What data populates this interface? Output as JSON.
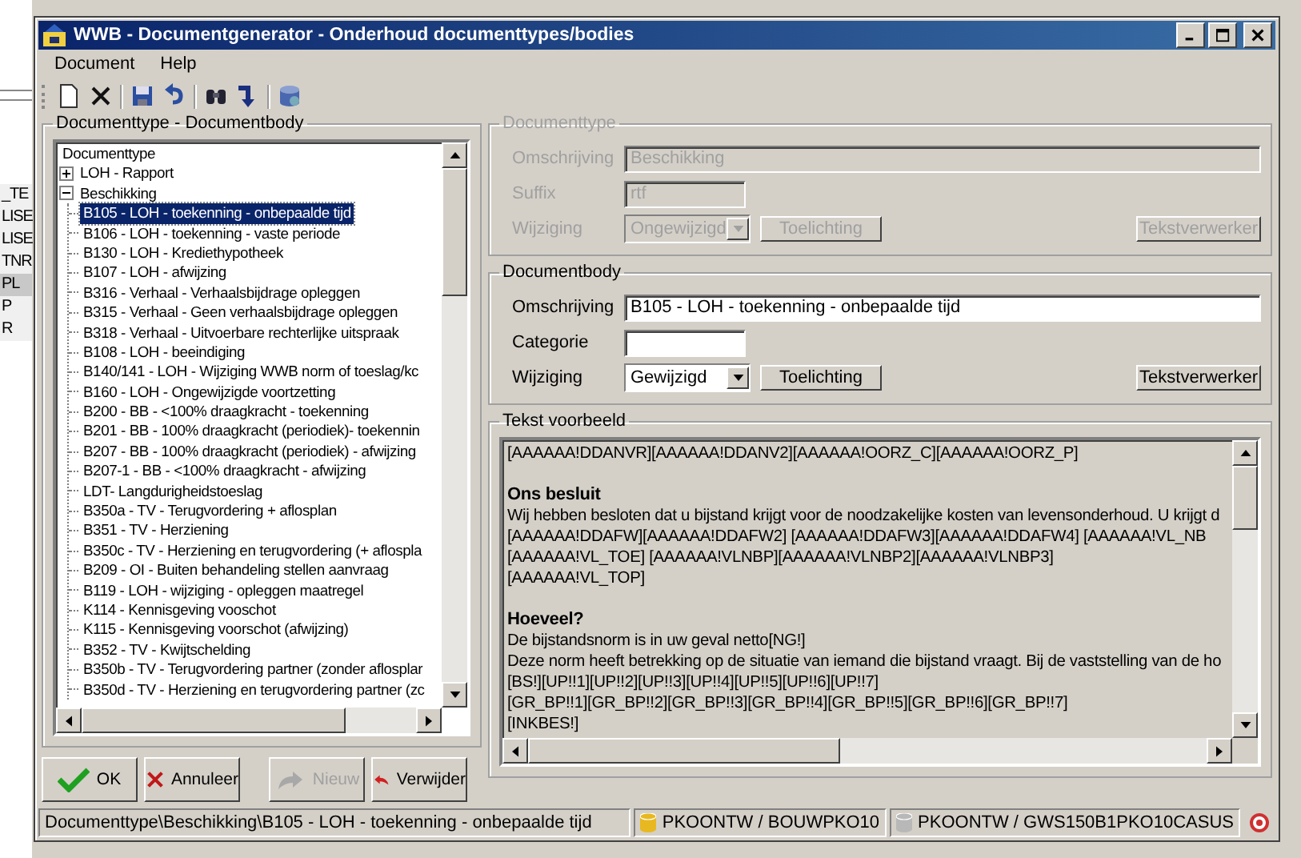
{
  "background_list": [
    {
      "label": "_TE",
      "selected": false
    },
    {
      "label": "LISE",
      "selected": false
    },
    {
      "label": "LISE",
      "selected": false
    },
    {
      "label": "TNR",
      "selected": false
    },
    {
      "label": "PL",
      "selected": true
    },
    {
      "label": "P",
      "selected": false
    },
    {
      "label": "R",
      "selected": false
    }
  ],
  "window": {
    "title": "WWB - Documentgenerator - Onderhoud documenttypes/bodies"
  },
  "menu": [
    "Document",
    "Help"
  ],
  "tree_panel": {
    "title": "Documenttype - Documentbody",
    "tree": {
      "label": "Documenttype",
      "selected": false,
      "children": [
        {
          "label": "LOH - Rapport",
          "expanded": false,
          "selected": false
        },
        {
          "label": "Beschikking",
          "expanded": true,
          "selected": false,
          "children": [
            {
              "label": "B105 - LOH - toekenning - onbepaalde tijd",
              "selected": true
            },
            {
              "label": "B106 - LOH - toekenning - vaste periode",
              "selected": false
            },
            {
              "label": "B130 - LOH - Krediethypotheek",
              "selected": false
            },
            {
              "label": "B107 - LOH - afwijzing",
              "selected": false
            },
            {
              "label": "B316 - Verhaal - Verhaalsbijdrage opleggen",
              "selected": false
            },
            {
              "label": "B315 - Verhaal - Geen verhaalsbijdrage opleggen",
              "selected": false
            },
            {
              "label": "B318 - Verhaal - Uitvoerbare rechterlijke uitspraak",
              "selected": false
            },
            {
              "label": "B108 - LOH - beeindiging",
              "selected": false
            },
            {
              "label": "B140/141 - LOH - Wijziging WWB norm of toeslag/kc",
              "selected": false
            },
            {
              "label": "B160 - LOH - Ongewijzigde voortzetting",
              "selected": false
            },
            {
              "label": "B200 - BB - <100% draagkracht - toekenning",
              "selected": false
            },
            {
              "label": "B201 - BB - 100% draagkracht  (periodiek)- toekennin",
              "selected": false
            },
            {
              "label": "B207 - BB - 100% draagkracht (periodiek) - afwijzing",
              "selected": false
            },
            {
              "label": "B207-1 - BB - <100% draagkracht - afwijzing",
              "selected": false
            },
            {
              "label": "LDT- Langdurigheidstoeslag",
              "selected": false
            },
            {
              "label": "B350a - TV - Terugvordering + aflosplan",
              "selected": false
            },
            {
              "label": "B351   - TV - Herziening",
              "selected": false
            },
            {
              "label": "B350c - TV - Herziening en terugvordering (+ aflospla",
              "selected": false
            },
            {
              "label": "B209 - OI - Buiten behandeling stellen aanvraag",
              "selected": false
            },
            {
              "label": "B119 - LOH - wijziging - opleggen maatregel",
              "selected": false
            },
            {
              "label": "K114 - Kennisgeving vooschot",
              "selected": false
            },
            {
              "label": "K115 - Kennisgeving voorschot (afwijzing)",
              "selected": false
            },
            {
              "label": "B352 - TV - Kwijtschelding",
              "selected": false
            },
            {
              "label": "B350b - TV - Terugvordering partner (zonder aflosplar",
              "selected": false
            },
            {
              "label": "B350d - TV - Herziening en terugvordering partner (zc",
              "selected": false
            }
          ]
        }
      ]
    }
  },
  "documenttype": {
    "title": "Documenttype",
    "disabled": true,
    "fields": [
      {
        "kind": "text",
        "label": "Omschrijving",
        "value": "Beschikking",
        "wide": true
      },
      {
        "kind": "text",
        "label": "Suffix",
        "value": "rtf",
        "wide": false
      },
      {
        "kind": "combo",
        "label": "Wijziging",
        "value": "Ongewijzigd",
        "buttons": [
          "Toelichting",
          "Tekstverwerker"
        ]
      }
    ]
  },
  "documentbody": {
    "title": "Documentbody",
    "disabled": false,
    "fields": [
      {
        "kind": "text",
        "label": "Omschrijving",
        "value": "B105 - LOH - toekenning - onbepaalde tijd",
        "wide": true
      },
      {
        "kind": "text",
        "label": "Categorie",
        "wide": false
      },
      {
        "kind": "combo",
        "label": "Wijziging",
        "value": "Gewijzigd",
        "buttons": [
          "Toelichting",
          "Tekstverwerker"
        ]
      }
    ]
  },
  "preview": {
    "title": "Tekst voorbeeld",
    "lines": [
      {
        "kind": "text",
        "text": "[AAAAAA!DDANVR][AAAAAA!DDANV2][AAAAAA!OORZ_C][AAAAAA!OORZ_P]"
      },
      {
        "kind": "blank"
      },
      {
        "kind": "heading",
        "text": "Ons besluit"
      },
      {
        "kind": "text",
        "text": "Wij hebben besloten dat u bijstand krijgt voor de noodzakelijke kosten van levensonderhoud. U krijgt d"
      },
      {
        "kind": "text",
        "text": "[AAAAAA!DDAFW][AAAAAA!DDAFW2] [AAAAAA!DDAFW3][AAAAAA!DDAFW4] [AAAAAA!VL_NB"
      },
      {
        "kind": "text",
        "text": "[AAAAAA!VL_TOE] [AAAAAA!VLNBP][AAAAAA!VLNBP2][AAAAAA!VLNBP3]"
      },
      {
        "kind": "text",
        "text": "[AAAAAA!VL_TOP]"
      },
      {
        "kind": "blank"
      },
      {
        "kind": "heading",
        "text": "Hoeveel?"
      },
      {
        "kind": "text",
        "text": "De bijstandsnorm is in uw geval netto[NG!]"
      },
      {
        "kind": "text",
        "text": "Deze norm heeft betrekking op de situatie van iemand die bijstand vraagt. Bij de vaststelling van de ho"
      },
      {
        "kind": "text",
        "text": "[BS!][UP!!1][UP!!2][UP!!3][UP!!4][UP!!5][UP!!6][UP!!7]"
      },
      {
        "kind": "text",
        "text": "[GR_BP!!1][GR_BP!!2][GR_BP!!3][GR_BP!!4][GR_BP!!5][GR_BP!!6][GR_BP!!7]"
      },
      {
        "kind": "text",
        "text": "[INKBES!]"
      }
    ]
  },
  "buttons": [
    {
      "kind": "ok",
      "label": "OK",
      "disabled": false
    },
    {
      "kind": "cancel",
      "label": "Annuleer",
      "disabled": false
    },
    {
      "kind": "new",
      "label": "Nieuw",
      "disabled": true
    },
    {
      "kind": "delete",
      "label": "Verwijder",
      "disabled": false
    }
  ],
  "status_bar": {
    "path": "Documenttype\\Beschikking\\B105 - LOH - toekenning - onbepaalde tijd",
    "connections": [
      {
        "label": "PKOONTW / BOUWPKO10",
        "color": "#e8b820"
      },
      {
        "label": "PKOONTW / GWS150B1PKO10CASUS",
        "color": "#b8b8b8"
      }
    ]
  }
}
